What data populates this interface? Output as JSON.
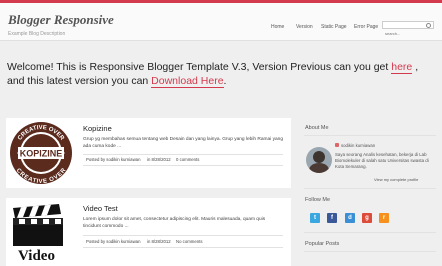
{
  "header": {
    "title": "Blogger Responsive",
    "tagline": "Example Blog Description",
    "nav": [
      "Home",
      "Version",
      "Static Page",
      "Error Page"
    ],
    "search_placeholder": "search...",
    "accent": "#d33a4e"
  },
  "welcome": {
    "text_before": "Welcome! This is Responsive Blogger Template V.3, Version Previous can you get",
    "link_here": "here",
    "text_middle": ", and this latest version you can",
    "link_download": "Download Here",
    "text_end": "."
  },
  "posts": [
    {
      "title": "Kopizine",
      "snippet": "Grup yg membahas semua tentang web Desain dan yang lainya. Grup yang lebih Ramai yang ada cuma kode ...",
      "author": "Posted by sodikin kurniawan",
      "date": "in 8/28/2012",
      "comments": "0 comments",
      "image_text_top": "CREATIVE OVER",
      "image_text_mid": "KOPIZINE",
      "image_text_bottom": "CREATIVE OVER",
      "icon": "kopizine-logo"
    },
    {
      "title": "Video Test",
      "snippet": "Lorem ipsum dolor sit amet, consectetur adipiscing elit. Mauris malesuada, quam quis tincidunt commodo ...",
      "author": "Posted by sodikin kurniawan",
      "date": "in 8/28/2012",
      "comments": "No comments",
      "image_caption": "Video",
      "icon": "clapperboard-icon"
    }
  ],
  "sidebar": {
    "about_title": "About Me",
    "author_name": "sodikin kurniawan",
    "bio": "Saya seorang Analis kesehatan, bekerja di Lab Biomolekuler di salah satu Universitas swasta di Kota Semarang.",
    "profile_link": "View my complete profile",
    "follow_title": "Follow Me",
    "social": [
      {
        "name": "twitter-icon",
        "glyph": "t",
        "color": "#3aa7e0"
      },
      {
        "name": "facebook-icon",
        "glyph": "f",
        "color": "#3b5998"
      },
      {
        "name": "delicious-icon",
        "glyph": "d",
        "color": "#3b8fd6"
      },
      {
        "name": "google-plus-icon",
        "glyph": "g",
        "color": "#dd4b39"
      },
      {
        "name": "rss-icon",
        "glyph": "r",
        "color": "#f6911e"
      }
    ],
    "popular_title": "Popular Posts"
  }
}
